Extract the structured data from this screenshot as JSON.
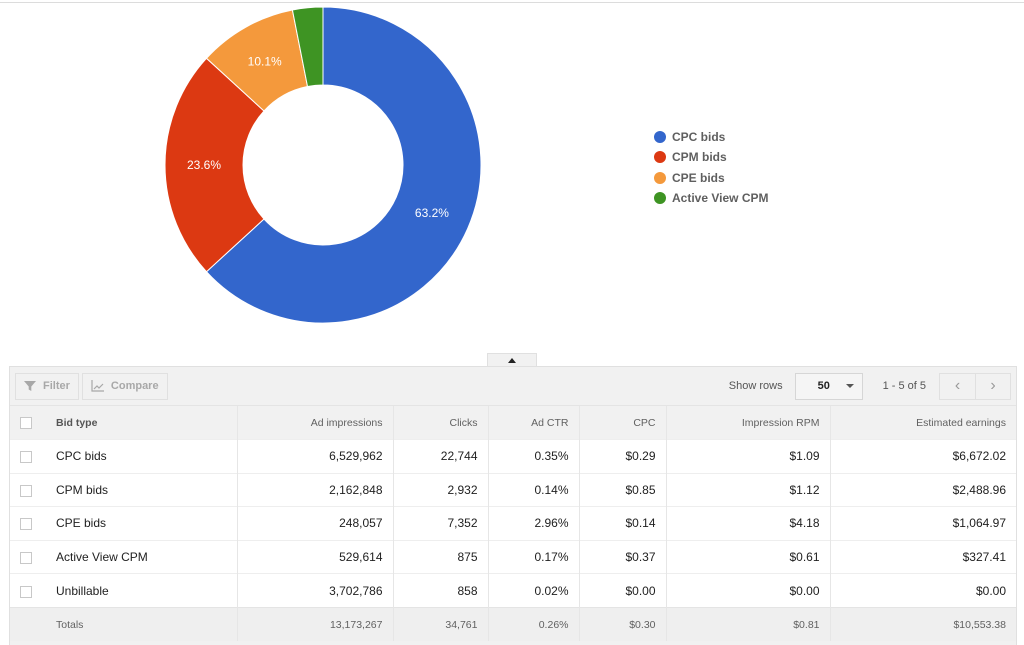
{
  "chart_data": {
    "type": "pie",
    "variant": "donut",
    "title": "",
    "categories": [
      "CPC bids",
      "CPM bids",
      "CPE bids",
      "Active View CPM"
    ],
    "values": [
      63.2,
      23.6,
      10.1,
      3.1
    ],
    "unit": "%",
    "slice_labels": [
      "63.2%",
      "23.6%",
      "10.1%",
      ""
    ],
    "colors": [
      "#3366cc",
      "#dc3912",
      "#f4993c",
      "#3e9423"
    ],
    "legend": {
      "position": "right",
      "entries": [
        "CPC bids",
        "CPM bids",
        "CPE bids",
        "Active View CPM"
      ]
    }
  },
  "collapse_toggle": {
    "icon": "triangle-up-icon"
  },
  "toolbar": {
    "filter_label": "Filter",
    "compare_label": "Compare",
    "show_rows_label": "Show rows",
    "rows_value": "50",
    "page_info": "1 - 5 of 5",
    "prev_icon": "‹",
    "next_icon": "›"
  },
  "table": {
    "columns": [
      "Bid type",
      "Ad impressions",
      "Clicks",
      "Ad CTR",
      "CPC",
      "Impression RPM",
      "Estimated earnings"
    ],
    "rows": [
      [
        "CPC bids",
        "6,529,962",
        "22,744",
        "0.35%",
        "$0.29",
        "$1.09",
        "$6,672.02"
      ],
      [
        "CPM bids",
        "2,162,848",
        "2,932",
        "0.14%",
        "$0.85",
        "$1.12",
        "$2,488.96"
      ],
      [
        "CPE bids",
        "248,057",
        "7,352",
        "2.96%",
        "$0.14",
        "$4.18",
        "$1,064.97"
      ],
      [
        "Active View CPM",
        "529,614",
        "875",
        "0.17%",
        "$0.37",
        "$0.61",
        "$327.41"
      ],
      [
        "Unbillable",
        "3,702,786",
        "858",
        "0.02%",
        "$0.00",
        "$0.00",
        "$0.00"
      ]
    ],
    "totals": [
      "Totals",
      "13,173,267",
      "34,761",
      "0.26%",
      "$0.30",
      "$0.81",
      "$10,553.38"
    ]
  }
}
